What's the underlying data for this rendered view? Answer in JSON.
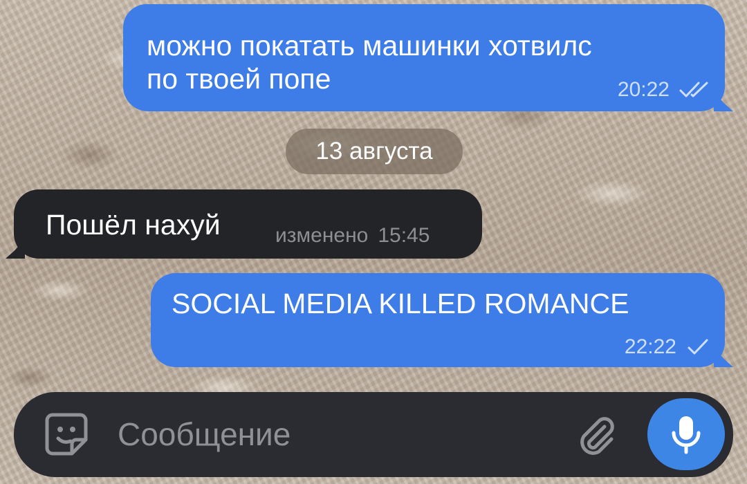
{
  "messages": [
    {
      "direction": "outgoing",
      "lines": [
        "можно покатать машинки хотвилс",
        "по твоей попе"
      ],
      "time": "20:22",
      "status": "read",
      "status_icon": "double-check-icon"
    },
    {
      "direction": "incoming",
      "lines": [
        "Пошёл нахуй"
      ],
      "edited_label": "изменено",
      "time": "15:45"
    },
    {
      "direction": "outgoing",
      "lines": [
        "SOCIAL MEDIA KILLED ROMANCE"
      ],
      "time": "22:22",
      "status": "sent",
      "status_icon": "single-check-icon"
    }
  ],
  "date_separator": "13 августа",
  "composer": {
    "placeholder": "Сообщение",
    "left_icon": "sticker-icon",
    "attach_icon": "paperclip-icon",
    "send_icon": "microphone-icon"
  },
  "colors": {
    "outgoing_bubble": "#3e7de8",
    "incoming_bubble": "#232427",
    "composer_bg": "#2a2c31",
    "mic_button": "#3e86e6",
    "date_chip": "#786c60"
  }
}
